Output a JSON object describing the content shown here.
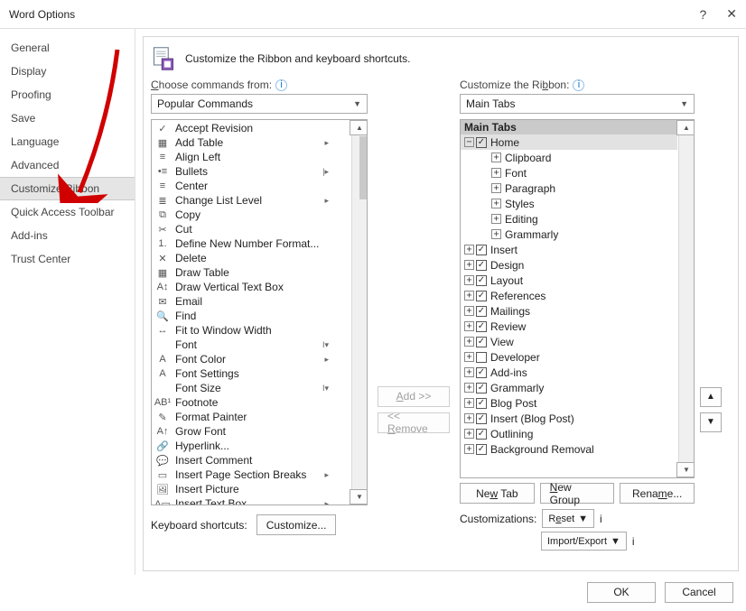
{
  "titlebar": {
    "title": "Word Options"
  },
  "sidebar": {
    "items": [
      {
        "label": "General"
      },
      {
        "label": "Display"
      },
      {
        "label": "Proofing"
      },
      {
        "label": "Save"
      },
      {
        "label": "Language"
      },
      {
        "label": "Advanced"
      },
      {
        "label": "Customize Ribbon",
        "selected": true
      },
      {
        "label": "Quick Access Toolbar"
      },
      {
        "label": "Add-ins"
      },
      {
        "label": "Trust Center"
      }
    ]
  },
  "heading": "Customize the Ribbon and keyboard shortcuts.",
  "left": {
    "label_html": "<u>C</u>hoose commands from:",
    "dropdown": "Popular Commands",
    "commands": [
      {
        "icon": "✓",
        "label": "Accept Revision"
      },
      {
        "icon": "▦",
        "label": "Add Table",
        "sub": "▸"
      },
      {
        "icon": "≡",
        "label": "Align Left"
      },
      {
        "icon": "•≡",
        "label": "Bullets",
        "sub": "|▸"
      },
      {
        "icon": "≡",
        "label": "Center"
      },
      {
        "icon": "≣",
        "label": "Change List Level",
        "sub": "▸"
      },
      {
        "icon": "⧉",
        "label": "Copy"
      },
      {
        "icon": "✂",
        "label": "Cut"
      },
      {
        "icon": "1.",
        "label": "Define New Number Format..."
      },
      {
        "icon": "✕",
        "label": "Delete"
      },
      {
        "icon": "▦",
        "label": "Draw Table"
      },
      {
        "icon": "A↕",
        "label": "Draw Vertical Text Box"
      },
      {
        "icon": "✉",
        "label": "Email"
      },
      {
        "icon": "🔍",
        "label": "Find"
      },
      {
        "icon": "↔",
        "label": "Fit to Window Width"
      },
      {
        "icon": "",
        "label": "Font",
        "sub": "I▾"
      },
      {
        "icon": "A",
        "label": "Font Color",
        "sub": "▸"
      },
      {
        "icon": "A",
        "label": "Font Settings"
      },
      {
        "icon": "",
        "label": "Font Size",
        "sub": "I▾"
      },
      {
        "icon": "AB¹",
        "label": "Footnote"
      },
      {
        "icon": "✎",
        "label": "Format Painter"
      },
      {
        "icon": "A↑",
        "label": "Grow Font"
      },
      {
        "icon": "🔗",
        "label": "Hyperlink..."
      },
      {
        "icon": "💬",
        "label": "Insert Comment"
      },
      {
        "icon": "▭",
        "label": "Insert Page  Section Breaks",
        "sub": "▸"
      },
      {
        "icon": "🖼",
        "label": "Insert Picture"
      },
      {
        "icon": "A▭",
        "label": "Insert Text Box",
        "sub": "▸"
      }
    ],
    "kb_label": "Keyboard shortcuts:",
    "kb_button": "Customize..."
  },
  "mid": {
    "add": "Add >>",
    "remove": "<< Remove"
  },
  "right": {
    "label_html": "Customize the Ri<u>b</u>bon:",
    "dropdown": "Main Tabs",
    "tree_header": "Main Tabs",
    "tree": [
      {
        "exp": "-",
        "chk": true,
        "label": "Home",
        "sel": true,
        "children": [
          {
            "exp": "+",
            "label": "Clipboard"
          },
          {
            "exp": "+",
            "label": "Font"
          },
          {
            "exp": "+",
            "label": "Paragraph"
          },
          {
            "exp": "+",
            "label": "Styles"
          },
          {
            "exp": "+",
            "label": "Editing"
          },
          {
            "exp": "+",
            "label": "Grammarly"
          }
        ]
      },
      {
        "exp": "+",
        "chk": true,
        "label": "Insert"
      },
      {
        "exp": "+",
        "chk": true,
        "label": "Design"
      },
      {
        "exp": "+",
        "chk": true,
        "label": "Layout"
      },
      {
        "exp": "+",
        "chk": true,
        "label": "References"
      },
      {
        "exp": "+",
        "chk": true,
        "label": "Mailings"
      },
      {
        "exp": "+",
        "chk": true,
        "label": "Review"
      },
      {
        "exp": "+",
        "chk": true,
        "label": "View"
      },
      {
        "exp": "+",
        "chk": false,
        "label": "Developer"
      },
      {
        "exp": "+",
        "chk": true,
        "label": "Add-ins"
      },
      {
        "exp": "+",
        "chk": true,
        "label": "Grammarly"
      },
      {
        "exp": "+",
        "chk": true,
        "label": "Blog Post"
      },
      {
        "exp": "+",
        "chk": true,
        "label": "Insert (Blog Post)"
      },
      {
        "exp": "+",
        "chk": true,
        "label": "Outlining"
      },
      {
        "exp": "+",
        "chk": true,
        "label": "Background Removal"
      }
    ],
    "buttons": {
      "new_tab": "New Tab",
      "new_group": "New Group",
      "rename": "Rename..."
    },
    "cust_label": "Customizations:",
    "reset": "Reset",
    "import_export": "Import/Export"
  },
  "footer": {
    "ok": "OK",
    "cancel": "Cancel"
  }
}
